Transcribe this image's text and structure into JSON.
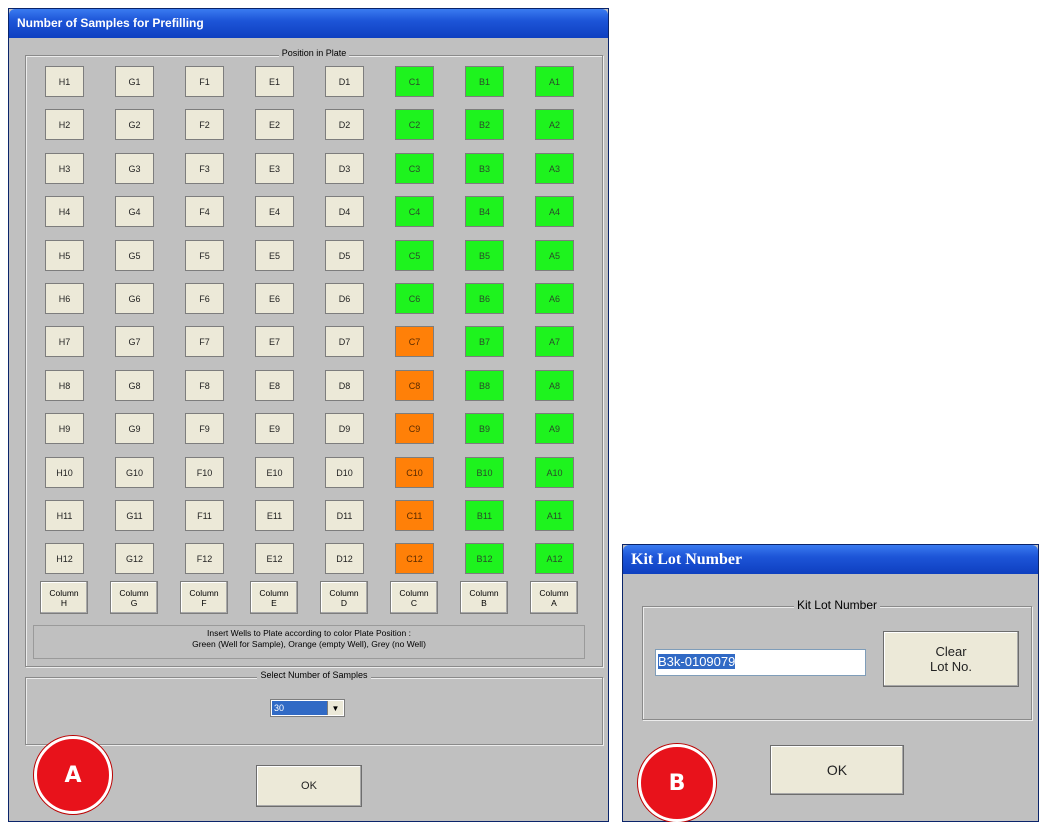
{
  "dialog_a": {
    "title": "Number of Samples for Prefilling",
    "plate_legend": "Position in Plate",
    "rows": [
      "1",
      "2",
      "3",
      "4",
      "5",
      "6",
      "7",
      "8",
      "9",
      "10",
      "11",
      "12"
    ],
    "columns": [
      {
        "letter": "H",
        "states": [
          "grey",
          "grey",
          "grey",
          "grey",
          "grey",
          "grey",
          "grey",
          "grey",
          "grey",
          "grey",
          "grey",
          "grey"
        ]
      },
      {
        "letter": "G",
        "states": [
          "grey",
          "grey",
          "grey",
          "grey",
          "grey",
          "grey",
          "grey",
          "grey",
          "grey",
          "grey",
          "grey",
          "grey"
        ]
      },
      {
        "letter": "F",
        "states": [
          "grey",
          "grey",
          "grey",
          "grey",
          "grey",
          "grey",
          "grey",
          "grey",
          "grey",
          "grey",
          "grey",
          "grey"
        ]
      },
      {
        "letter": "E",
        "states": [
          "grey",
          "grey",
          "grey",
          "grey",
          "grey",
          "grey",
          "grey",
          "grey",
          "grey",
          "grey",
          "grey",
          "grey"
        ]
      },
      {
        "letter": "D",
        "states": [
          "grey",
          "grey",
          "grey",
          "grey",
          "grey",
          "grey",
          "grey",
          "grey",
          "grey",
          "grey",
          "grey",
          "grey"
        ]
      },
      {
        "letter": "C",
        "states": [
          "green",
          "green",
          "green",
          "green",
          "green",
          "green",
          "orange",
          "orange",
          "orange",
          "orange",
          "orange",
          "orange"
        ]
      },
      {
        "letter": "B",
        "states": [
          "green",
          "green",
          "green",
          "green",
          "green",
          "green",
          "green",
          "green",
          "green",
          "green",
          "green",
          "green"
        ]
      },
      {
        "letter": "A",
        "states": [
          "green",
          "green",
          "green",
          "green",
          "green",
          "green",
          "green",
          "green",
          "green",
          "green",
          "green",
          "green"
        ]
      }
    ],
    "column_button_label": "Column",
    "info_line1": "Insert Wells to Plate according to color Plate Position :",
    "info_line2": "Green (Well for Sample), Orange (empty Well), Grey (no Well)",
    "samples_legend": "Select Number of Samples",
    "samples_value": "30",
    "ok_label": "OK",
    "badge": "A"
  },
  "dialog_b": {
    "title": "Kit Lot Number",
    "group_legend": "Kit Lot Number",
    "lot_value": "B3k-0109079",
    "clear_line1": "Clear",
    "clear_line2": "Lot No.",
    "ok_label": "OK",
    "badge": "B"
  },
  "colors": {
    "green_well": "#1ef31e",
    "orange_well": "#ff8008",
    "grey_well": "#ece9d8",
    "title_blue": "#1d55d8",
    "badge_red": "#e8121b"
  }
}
